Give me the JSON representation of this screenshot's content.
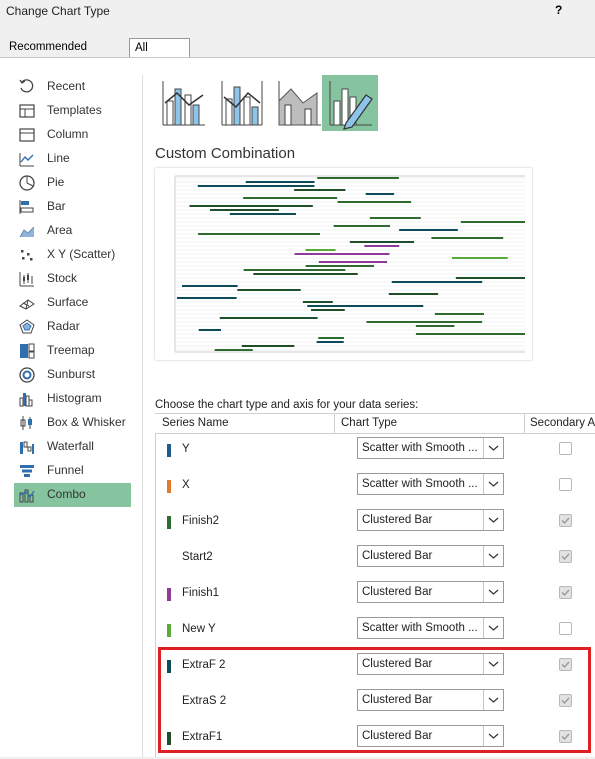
{
  "window": {
    "title": "Change Chart Type",
    "help": "?"
  },
  "tabs": [
    {
      "label": "Recommended Charts"
    },
    {
      "label": "All Charts"
    }
  ],
  "chart_types": [
    {
      "label": "Recent",
      "icon": "recent-icon"
    },
    {
      "label": "Templates",
      "icon": "templates-icon"
    },
    {
      "label": "Column",
      "icon": "column-chart-icon"
    },
    {
      "label": "Line",
      "icon": "line-chart-icon"
    },
    {
      "label": "Pie",
      "icon": "pie-chart-icon"
    },
    {
      "label": "Bar",
      "icon": "bar-chart-icon"
    },
    {
      "label": "Area",
      "icon": "area-chart-icon"
    },
    {
      "label": "X Y (Scatter)",
      "icon": "scatter-chart-icon"
    },
    {
      "label": "Stock",
      "icon": "stock-chart-icon"
    },
    {
      "label": "Surface",
      "icon": "surface-chart-icon"
    },
    {
      "label": "Radar",
      "icon": "radar-chart-icon"
    },
    {
      "label": "Treemap",
      "icon": "treemap-chart-icon"
    },
    {
      "label": "Sunburst",
      "icon": "sunburst-chart-icon"
    },
    {
      "label": "Histogram",
      "icon": "histogram-chart-icon"
    },
    {
      "label": "Box & Whisker",
      "icon": "box-whisker-chart-icon"
    },
    {
      "label": "Waterfall",
      "icon": "waterfall-chart-icon"
    },
    {
      "label": "Funnel",
      "icon": "funnel-chart-icon"
    },
    {
      "label": "Combo",
      "icon": "combo-chart-icon"
    }
  ],
  "selected_type": "Combo",
  "combo": {
    "heading": "Custom Combination",
    "choose_label": "Choose the chart type and axis for your data series:",
    "columns": {
      "series": "Series Name",
      "type": "Chart Type",
      "secondary": "Secondary Axis"
    }
  },
  "series": [
    {
      "name": "Y",
      "color": "#1f5c8a",
      "type": "Scatter with Smooth ...",
      "secondary": false,
      "enabled": true
    },
    {
      "name": "X",
      "color": "#e07a2e",
      "type": "Scatter with Smooth ...",
      "secondary": false,
      "enabled": true
    },
    {
      "name": "Finish2",
      "color": "#2e6b2e",
      "type": "Clustered Bar",
      "secondary": true,
      "enabled": false
    },
    {
      "name": "Start2",
      "color": "",
      "type": "Clustered Bar",
      "secondary": true,
      "enabled": false
    },
    {
      "name": "Finish1",
      "color": "#8e3c97",
      "type": "Clustered Bar",
      "secondary": true,
      "enabled": false
    },
    {
      "name": "New Y",
      "color": "#5aaa3a",
      "type": "Scatter with Smooth ...",
      "secondary": false,
      "enabled": true
    },
    {
      "name": "ExtraF 2",
      "color": "#0e4a5a",
      "type": "Clustered Bar",
      "secondary": true,
      "enabled": false
    },
    {
      "name": "ExtraS 2",
      "color": "",
      "type": "Clustered Bar",
      "secondary": true,
      "enabled": false
    },
    {
      "name": "ExtraF1",
      "color": "#1e4f2a",
      "type": "Clustered Bar",
      "secondary": true,
      "enabled": false
    }
  ],
  "colors": {
    "selection": "#86c49f",
    "highlight": "#e02020"
  }
}
